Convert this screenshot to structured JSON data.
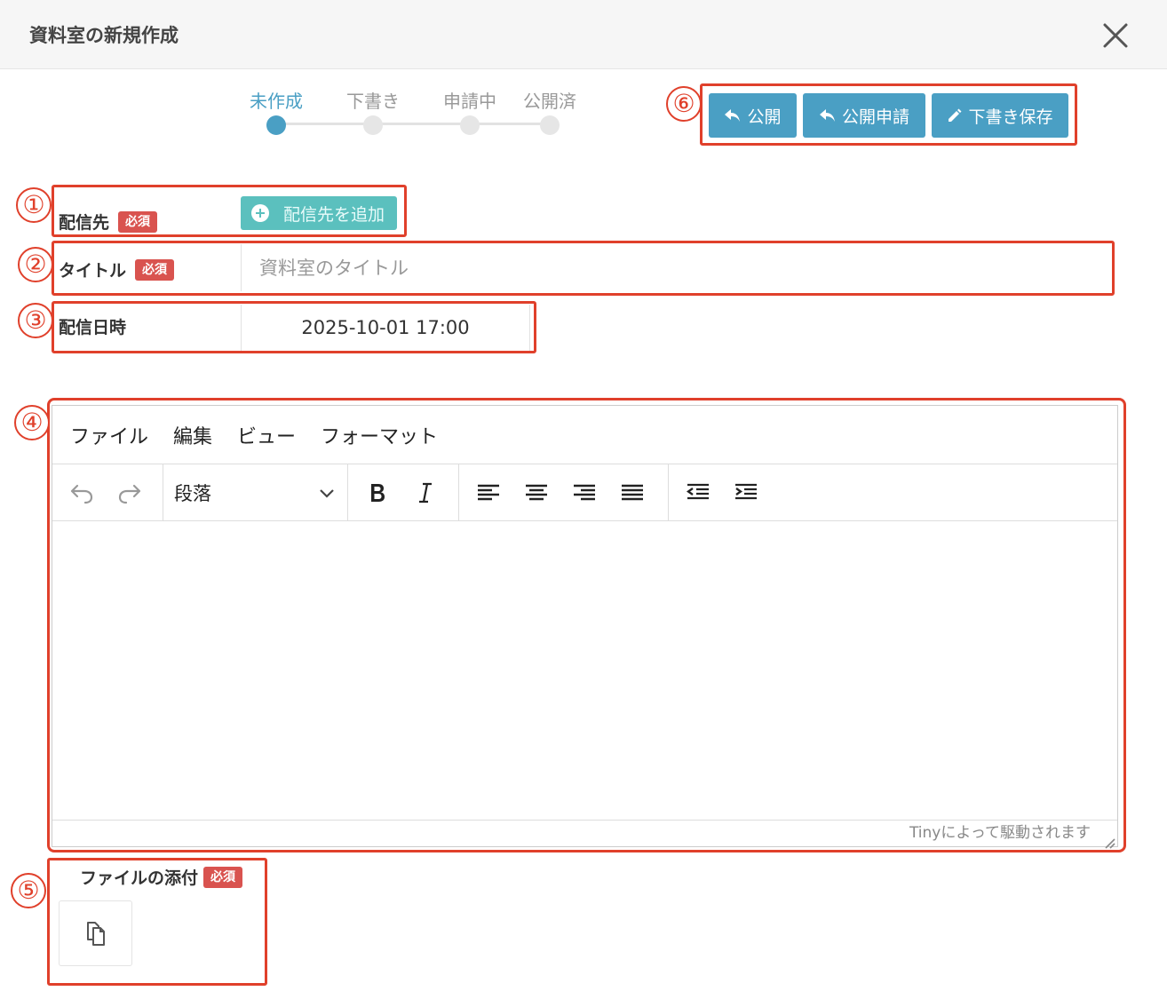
{
  "modal": {
    "title": "資料室の新規作成"
  },
  "steps": [
    {
      "label": "未作成",
      "active": true
    },
    {
      "label": "下書き",
      "active": false
    },
    {
      "label": "申請中",
      "active": false
    },
    {
      "label": "公開済",
      "active": false
    }
  ],
  "actions": {
    "publish_label": "公開",
    "request_label": "公開申請",
    "draft_label": "下書き保存"
  },
  "form": {
    "destination_label": "配信先",
    "required_label": "必須",
    "add_destination_label": "配信先を追加",
    "title_label": "タイトル",
    "title_placeholder": "資料室のタイトル",
    "title_value": "",
    "datetime_label": "配信日時",
    "datetime_value": "2025-10-01 17:00",
    "attachment_label": "ファイルの添付"
  },
  "editor": {
    "menu": [
      "ファイル",
      "編集",
      "ビュー",
      "フォーマット"
    ],
    "block_format": "段落",
    "status": "Tinyによって駆動されます"
  },
  "annotations": [
    "①",
    "②",
    "③",
    "④",
    "⑤",
    "⑥"
  ],
  "colors": {
    "accent": "#4a9fc4",
    "add_button": "#5bc0be",
    "required_badge": "#d9534f",
    "annotation": "#e0402b"
  }
}
